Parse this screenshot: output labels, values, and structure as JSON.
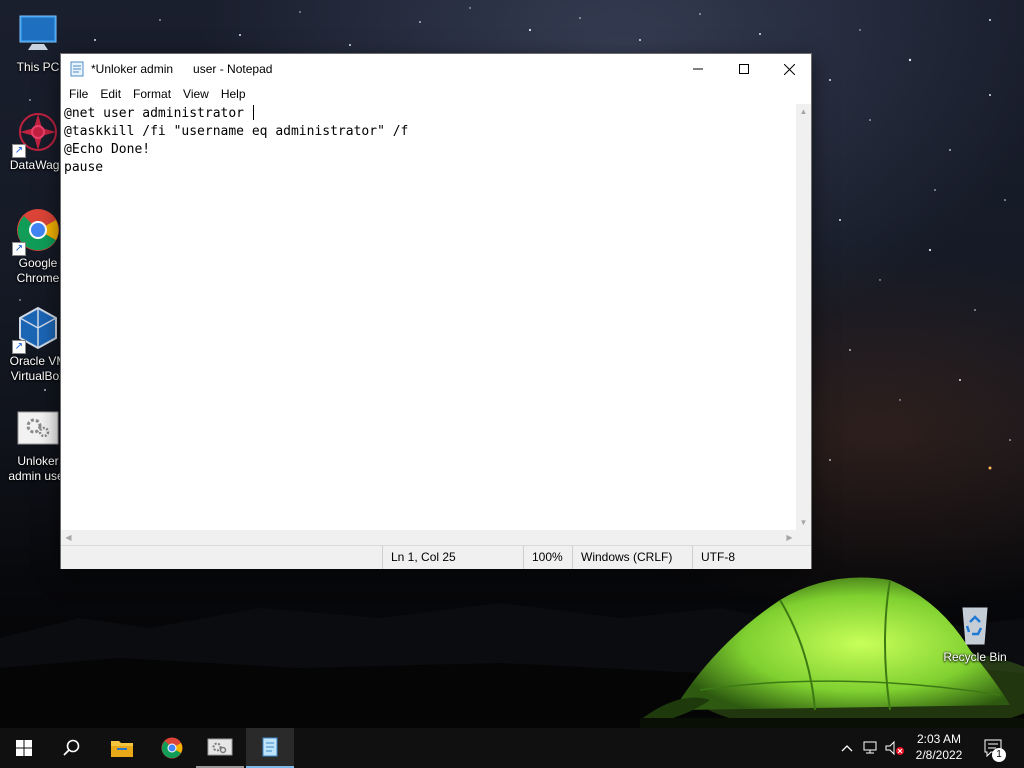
{
  "desktop": {
    "icons": [
      {
        "label": "This PC",
        "icon": "this-pc-icon"
      },
      {
        "label": "DataWago",
        "icon": "datawagon-icon"
      },
      {
        "label": "Google Chrome",
        "icon": "chrome-icon"
      },
      {
        "label": "Oracle VM VirtualBox",
        "icon": "virtualbox-icon"
      },
      {
        "label": "Unloker admin user",
        "icon": "batch-file-icon"
      },
      {
        "label": "Recycle Bin",
        "icon": "recycle-bin-icon"
      }
    ]
  },
  "notepad": {
    "title": "*Unloker admin      user - Notepad",
    "menu": [
      "File",
      "Edit",
      "Format",
      "View",
      "Help"
    ],
    "lines": [
      "@net user administrator ",
      "@taskkill /fi \"username eq administrator\" /f",
      "@Echo Done!",
      "pause"
    ],
    "status": {
      "position": "Ln 1, Col 25",
      "zoom": "100%",
      "line_ending": "Windows (CRLF)",
      "encoding": "UTF-8"
    }
  },
  "taskbar": {
    "pinned": [
      "start-icon",
      "search-icon",
      "file-explorer-icon",
      "chrome-icon",
      "unloker-batch-icon",
      "notepad-icon"
    ],
    "clock": {
      "time": "2:03 AM",
      "date": "2/8/2022"
    },
    "notification_count": "1"
  },
  "colors": {
    "taskbar_bg": "#101010",
    "active_indicator": "#7cb8e8",
    "tent_green": "#8fe03a"
  }
}
